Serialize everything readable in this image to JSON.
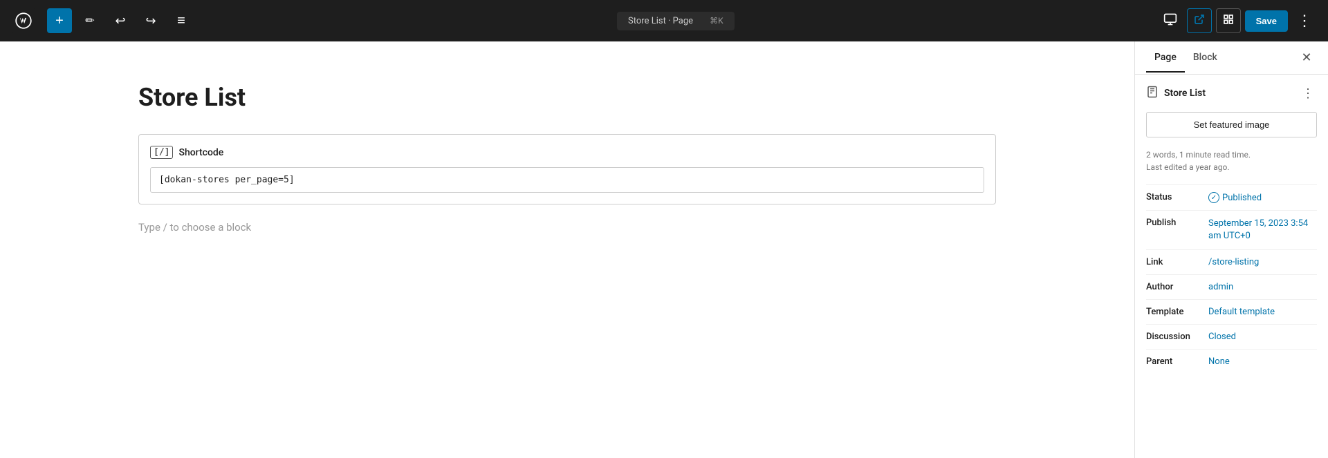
{
  "toolbar": {
    "add_label": "+",
    "edit_icon": "✏",
    "undo_icon": "↩",
    "redo_icon": "↪",
    "list_icon": "≡",
    "page_title": "Store List · Page",
    "shortcut": "⌘K",
    "preview_icon": "⊡",
    "editor_icon": "▣",
    "settings_icon": "◧",
    "save_label": "Save",
    "more_icon": "⋮"
  },
  "sidebar": {
    "tab_page": "Page",
    "tab_block": "Block",
    "close_icon": "✕",
    "doc_title": "Store List",
    "doc_more_icon": "⋮",
    "featured_image_btn": "Set featured image",
    "meta_text_line1": "2 words, 1 minute read time.",
    "meta_text_line2": "Last edited a year ago.",
    "status_label": "Status",
    "status_value": "Published",
    "publish_label": "Publish",
    "publish_value": "September 15, 2023 3:54 am UTC+0",
    "link_label": "Link",
    "link_value": "/store-listing",
    "author_label": "Author",
    "author_value": "admin",
    "template_label": "Template",
    "template_value": "Default template",
    "discussion_label": "Discussion",
    "discussion_value": "Closed",
    "parent_label": "Parent",
    "parent_value": "None"
  },
  "editor": {
    "page_heading": "Store List",
    "shortcode_label": "Shortcode",
    "shortcode_value": "[dokan-stores per_page=5]",
    "type_hint": "Type / to choose a block"
  }
}
